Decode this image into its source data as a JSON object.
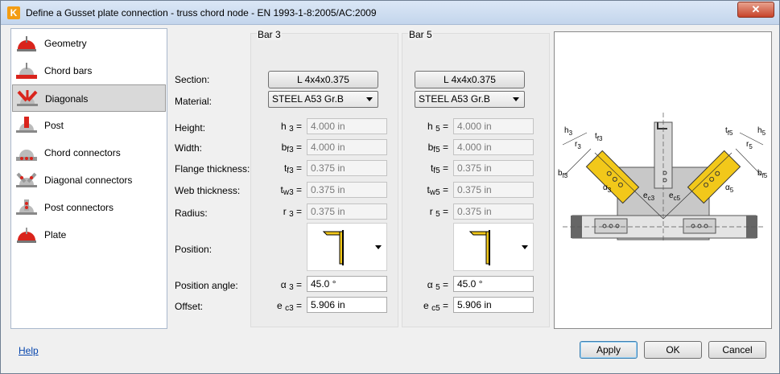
{
  "window": {
    "title": "Define a Gusset plate connection - truss chord node - EN 1993-1-8:2005/AC:2009",
    "app_icon": "K",
    "close_glyph": "✕"
  },
  "nav": {
    "items": [
      {
        "label": "Geometry",
        "icon": "geometry-icon"
      },
      {
        "label": "Chord bars",
        "icon": "chord-bars-icon"
      },
      {
        "label": "Diagonals",
        "icon": "diagonals-icon",
        "selected": true
      },
      {
        "label": "Post",
        "icon": "post-icon"
      },
      {
        "label": "Chord connectors",
        "icon": "chord-connectors-icon"
      },
      {
        "label": "Diagonal connectors",
        "icon": "diagonal-connectors-icon"
      },
      {
        "label": "Post connectors",
        "icon": "post-connectors-icon"
      },
      {
        "label": "Plate",
        "icon": "plate-icon"
      }
    ]
  },
  "labels": {
    "section": "Section:",
    "material": "Material:",
    "height": "Height:",
    "width": "Width:",
    "flange_thickness": "Flange thickness:",
    "web_thickness": "Web thickness:",
    "radius": "Radius:",
    "position": "Position:",
    "position_angle": "Position angle:",
    "offset": "Offset:"
  },
  "bar3": {
    "title": "Bar 3",
    "section": "L 4x4x0.375",
    "material": "STEEL A53 Gr.B",
    "sym": {
      "h": "h",
      "h_sub": "3",
      "b": "b",
      "b_sub": "f3",
      "tf": "t",
      "tf_sub": "f3",
      "tw": "t",
      "tw_sub": "w3",
      "r": "r",
      "r_sub": "3",
      "a": "α",
      "a_sub": "3",
      "e": "e",
      "e_sub": "c3",
      "eq": "="
    },
    "height": "4.000 in",
    "width": "4.000 in",
    "flange_thickness": "0.375 in",
    "web_thickness": "0.375 in",
    "radius": "0.375 in",
    "position_angle": "45.0 °",
    "offset": "5.906 in"
  },
  "bar5": {
    "title": "Bar 5",
    "section": "L 4x4x0.375",
    "material": "STEEL A53 Gr.B",
    "sym": {
      "h": "h",
      "h_sub": "5",
      "b": "b",
      "b_sub": "f5",
      "tf": "t",
      "tf_sub": "f5",
      "tw": "t",
      "tw_sub": "w5",
      "r": "r",
      "r_sub": "5",
      "a": "α",
      "a_sub": "5",
      "e": "e",
      "e_sub": "c5",
      "eq": "="
    },
    "height": "4.000 in",
    "width": "4.000 in",
    "flange_thickness": "0.375 in",
    "web_thickness": "0.375 in",
    "radius": "0.375 in",
    "position_angle": "45.0 °",
    "offset": "5.906 in"
  },
  "preview": {
    "labels": {
      "h3": "h",
      "h3s": "3",
      "r3": "r",
      "r3s": "3",
      "tf3": "t",
      "tf3s": "f3",
      "bf3": "b",
      "bf3s": "f3",
      "a3": "α",
      "a3s": "3",
      "ec3": "e",
      "ec3s": "c3",
      "ec5": "e",
      "ec5s": "c5",
      "a5": "α",
      "a5s": "5",
      "h5": "h",
      "h5s": "5",
      "r5": "r",
      "r5s": "5",
      "tf5": "t",
      "tf5s": "f5",
      "bf5": "b",
      "bf5s": "f5"
    },
    "colors": {
      "diagonal": "#f2c81a",
      "plate": "#c8c8c8",
      "chord": "#d0d0d0"
    }
  },
  "footer": {
    "help": "Help",
    "apply": "Apply",
    "ok": "OK",
    "cancel": "Cancel"
  },
  "colors": {
    "icon_red": "#d9241c",
    "link": "#0645ad"
  }
}
